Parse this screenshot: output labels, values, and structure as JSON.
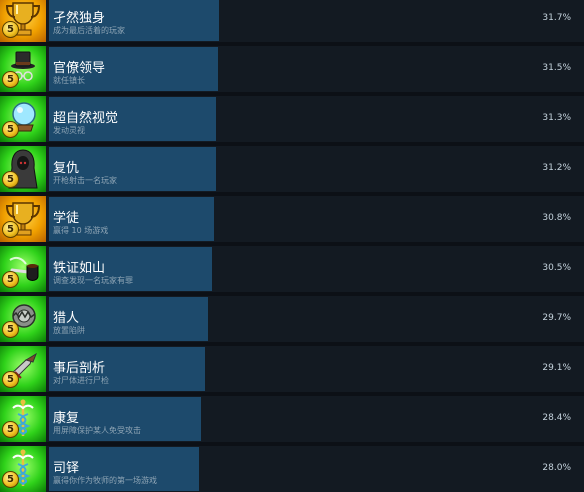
{
  "colors": {
    "row_background": "#131a22",
    "progress_bar": "#1d4a6c",
    "gold_tile": "#f0a000",
    "green_tile": "#2fd21a",
    "title_text": "#ffffff",
    "description_text": "#8fa5b5",
    "percent_text": "#c5d3dd"
  },
  "achievements": [
    {
      "title": "孑然独身",
      "description": "成为最后活着的玩家",
      "percent": "31.7%",
      "fill": 0.317,
      "points": "5",
      "tile": "gold",
      "icon": "trophy-icon"
    },
    {
      "title": "官僚领导",
      "description": "就任镇长",
      "percent": "31.5%",
      "fill": 0.315,
      "points": "5",
      "tile": "green",
      "icon": "top-hat-icon"
    },
    {
      "title": "超自然视觉",
      "description": "发动灵视",
      "percent": "31.3%",
      "fill": 0.313,
      "points": "5",
      "tile": "green",
      "icon": "crystal-ball-icon"
    },
    {
      "title": "复仇",
      "description": "开枪射击一名玩家",
      "percent": "31.2%",
      "fill": 0.312,
      "points": "5",
      "tile": "green",
      "icon": "hooded-figure-icon"
    },
    {
      "title": "学徒",
      "description": "赢得 10 场游戏",
      "percent": "30.8%",
      "fill": 0.308,
      "points": "5",
      "tile": "gold",
      "icon": "trophy-icon"
    },
    {
      "title": "铁证如山",
      "description": "调查发现一名玩家有罪",
      "percent": "30.5%",
      "fill": 0.305,
      "points": "5",
      "tile": "green",
      "icon": "pipe-icon"
    },
    {
      "title": "猎人",
      "description": "放置陷阱",
      "percent": "29.7%",
      "fill": 0.297,
      "points": "5",
      "tile": "green",
      "icon": "bear-trap-icon"
    },
    {
      "title": "事后剖析",
      "description": "对尸体进行尸检",
      "percent": "29.1%",
      "fill": 0.291,
      "points": "5",
      "tile": "green",
      "icon": "scalpel-icon"
    },
    {
      "title": "康复",
      "description": "用屏障保护某人免受攻击",
      "percent": "28.4%",
      "fill": 0.284,
      "points": "5",
      "tile": "green",
      "icon": "caduceus-icon"
    },
    {
      "title": "司铎",
      "description": "赢得你作为牧师的第一场游戏",
      "percent": "28.0%",
      "fill": 0.28,
      "points": "5",
      "tile": "green",
      "icon": "caduceus-icon"
    }
  ]
}
